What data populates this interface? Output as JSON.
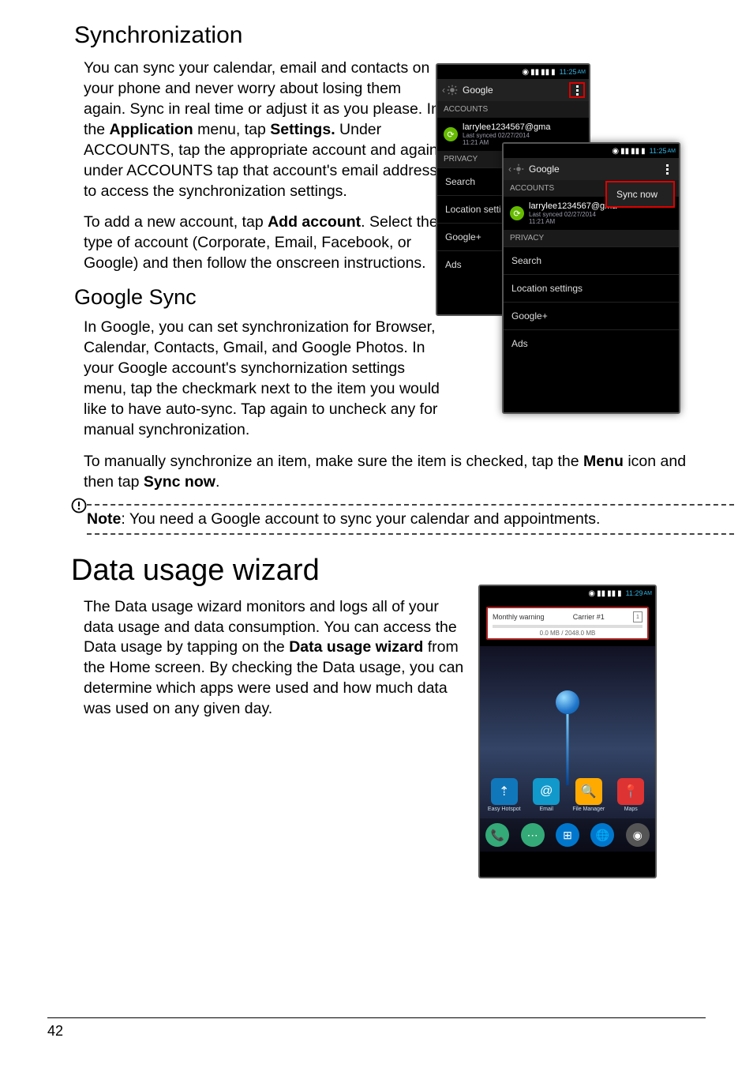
{
  "page_number": "42",
  "headings": {
    "sync_h2": "Synchronization",
    "google_sync_h3": "Google Sync",
    "data_usage_h1": "Data usage wizard"
  },
  "paras": {
    "sync1_a": "You can sync your calendar, email and contacts on your phone and never worry about losing them again. Sync in real time or adjust it as you please. In the ",
    "sync1_b": "Application",
    "sync1_c": " menu, tap ",
    "sync1_d": "Settings.",
    "sync1_e": " Under ACCOUNTS, tap the appropriate account and again under ACCOUNTS tap that account's email address to access the synchronization settings.",
    "sync2_a": "To add a new account, tap ",
    "sync2_b": "Add account",
    "sync2_c": ". Select the type of account (Corporate, Email, Facebook, or Google) and then follow the onscreen instructions.",
    "gs1": "In Google, you can set synchronization for Browser, Calendar, Contacts, Gmail, and Google Photos. In your Google account's synchornization settings menu, tap the checkmark next to the item you would like to have auto-sync. Tap again to uncheck any for manual synchronization.",
    "gs2_a": "To manually synchronize an item, make sure the item is checked, tap the ",
    "gs2_b": "Menu",
    "gs2_c": " icon and then tap ",
    "gs2_d": "Sync now",
    "gs2_e": ".",
    "note_a": "Note",
    "note_b": ": You need a Google account to sync your calendar and appointments.",
    "du1_a": "The Data usage wizard monitors and logs all of your data usage and data consumption. You can access the Data usage by tapping on the ",
    "du1_b": "Data usage wizard",
    "du1_c": " from the Home screen. By checking the Data usage, you can determine which apps were used and how much data was used on any given day."
  },
  "phone1": {
    "status_time": "11:25",
    "status_ampm": "AM",
    "title": "Google",
    "accounts_header": "ACCOUNTS",
    "email": "larrylee1234567@gma",
    "last_synced": "Last synced 02/27/2014",
    "last_synced_time": "11:21 AM",
    "privacy_header": "PRIVACY",
    "items": {
      "search": "Search",
      "location": "Location setti",
      "gplus": "Google+",
      "ads": "Ads"
    }
  },
  "phone2": {
    "status_time": "11:25",
    "status_ampm": "AM",
    "title": "Google",
    "popup": "Sync now",
    "accounts_header": "ACCOUNTS",
    "email": "larrylee1234567@gma",
    "last_synced": "Last synced 02/27/2014",
    "last_synced_time": "11:21 AM",
    "privacy_header": "PRIVACY",
    "items": {
      "search": "Search",
      "location": "Location settings",
      "gplus": "Google+",
      "ads": "Ads"
    }
  },
  "phone3": {
    "status_time": "11:29",
    "status_ampm": "AM",
    "du_warning": "Monthly warning",
    "du_carrier": "Carrier #1",
    "du_sim": "1",
    "du_sub": "0.0 MB / 2048.0 MB",
    "apps": {
      "hotspot": "Easy Hotspot",
      "email": "Email",
      "file": "File Manager",
      "maps": "Maps"
    }
  }
}
